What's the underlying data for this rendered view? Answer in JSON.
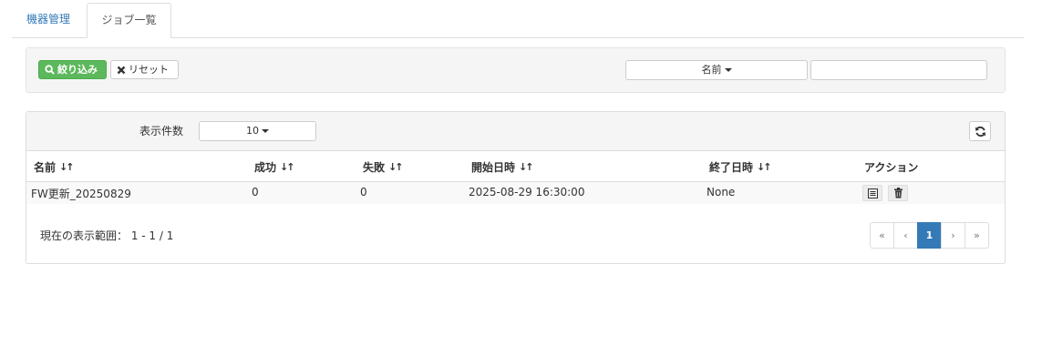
{
  "tabs": [
    {
      "label": "機器管理"
    },
    {
      "label": "ジョブ一覧"
    }
  ],
  "filter": {
    "filter_label": "絞り込み",
    "reset_label": "リセット",
    "field_select": "名前",
    "search_value": ""
  },
  "table": {
    "per_page_label": "表示件数",
    "per_page_value": "10",
    "columns": [
      "名前",
      "成功",
      "失敗",
      "開始日時",
      "終了日時",
      "アクション"
    ],
    "rows": [
      {
        "name": "FW更新_20250829",
        "success": "0",
        "failure": "0",
        "start": "2025-08-29 16:30:00",
        "end": "None"
      }
    ],
    "range_text": "現在の表示範囲： 1 - 1 / 1"
  },
  "pagination": [
    "«",
    "‹",
    "1",
    "›",
    "»"
  ],
  "colors": {
    "accent": "#337ab7",
    "success": "#5cb85c"
  }
}
